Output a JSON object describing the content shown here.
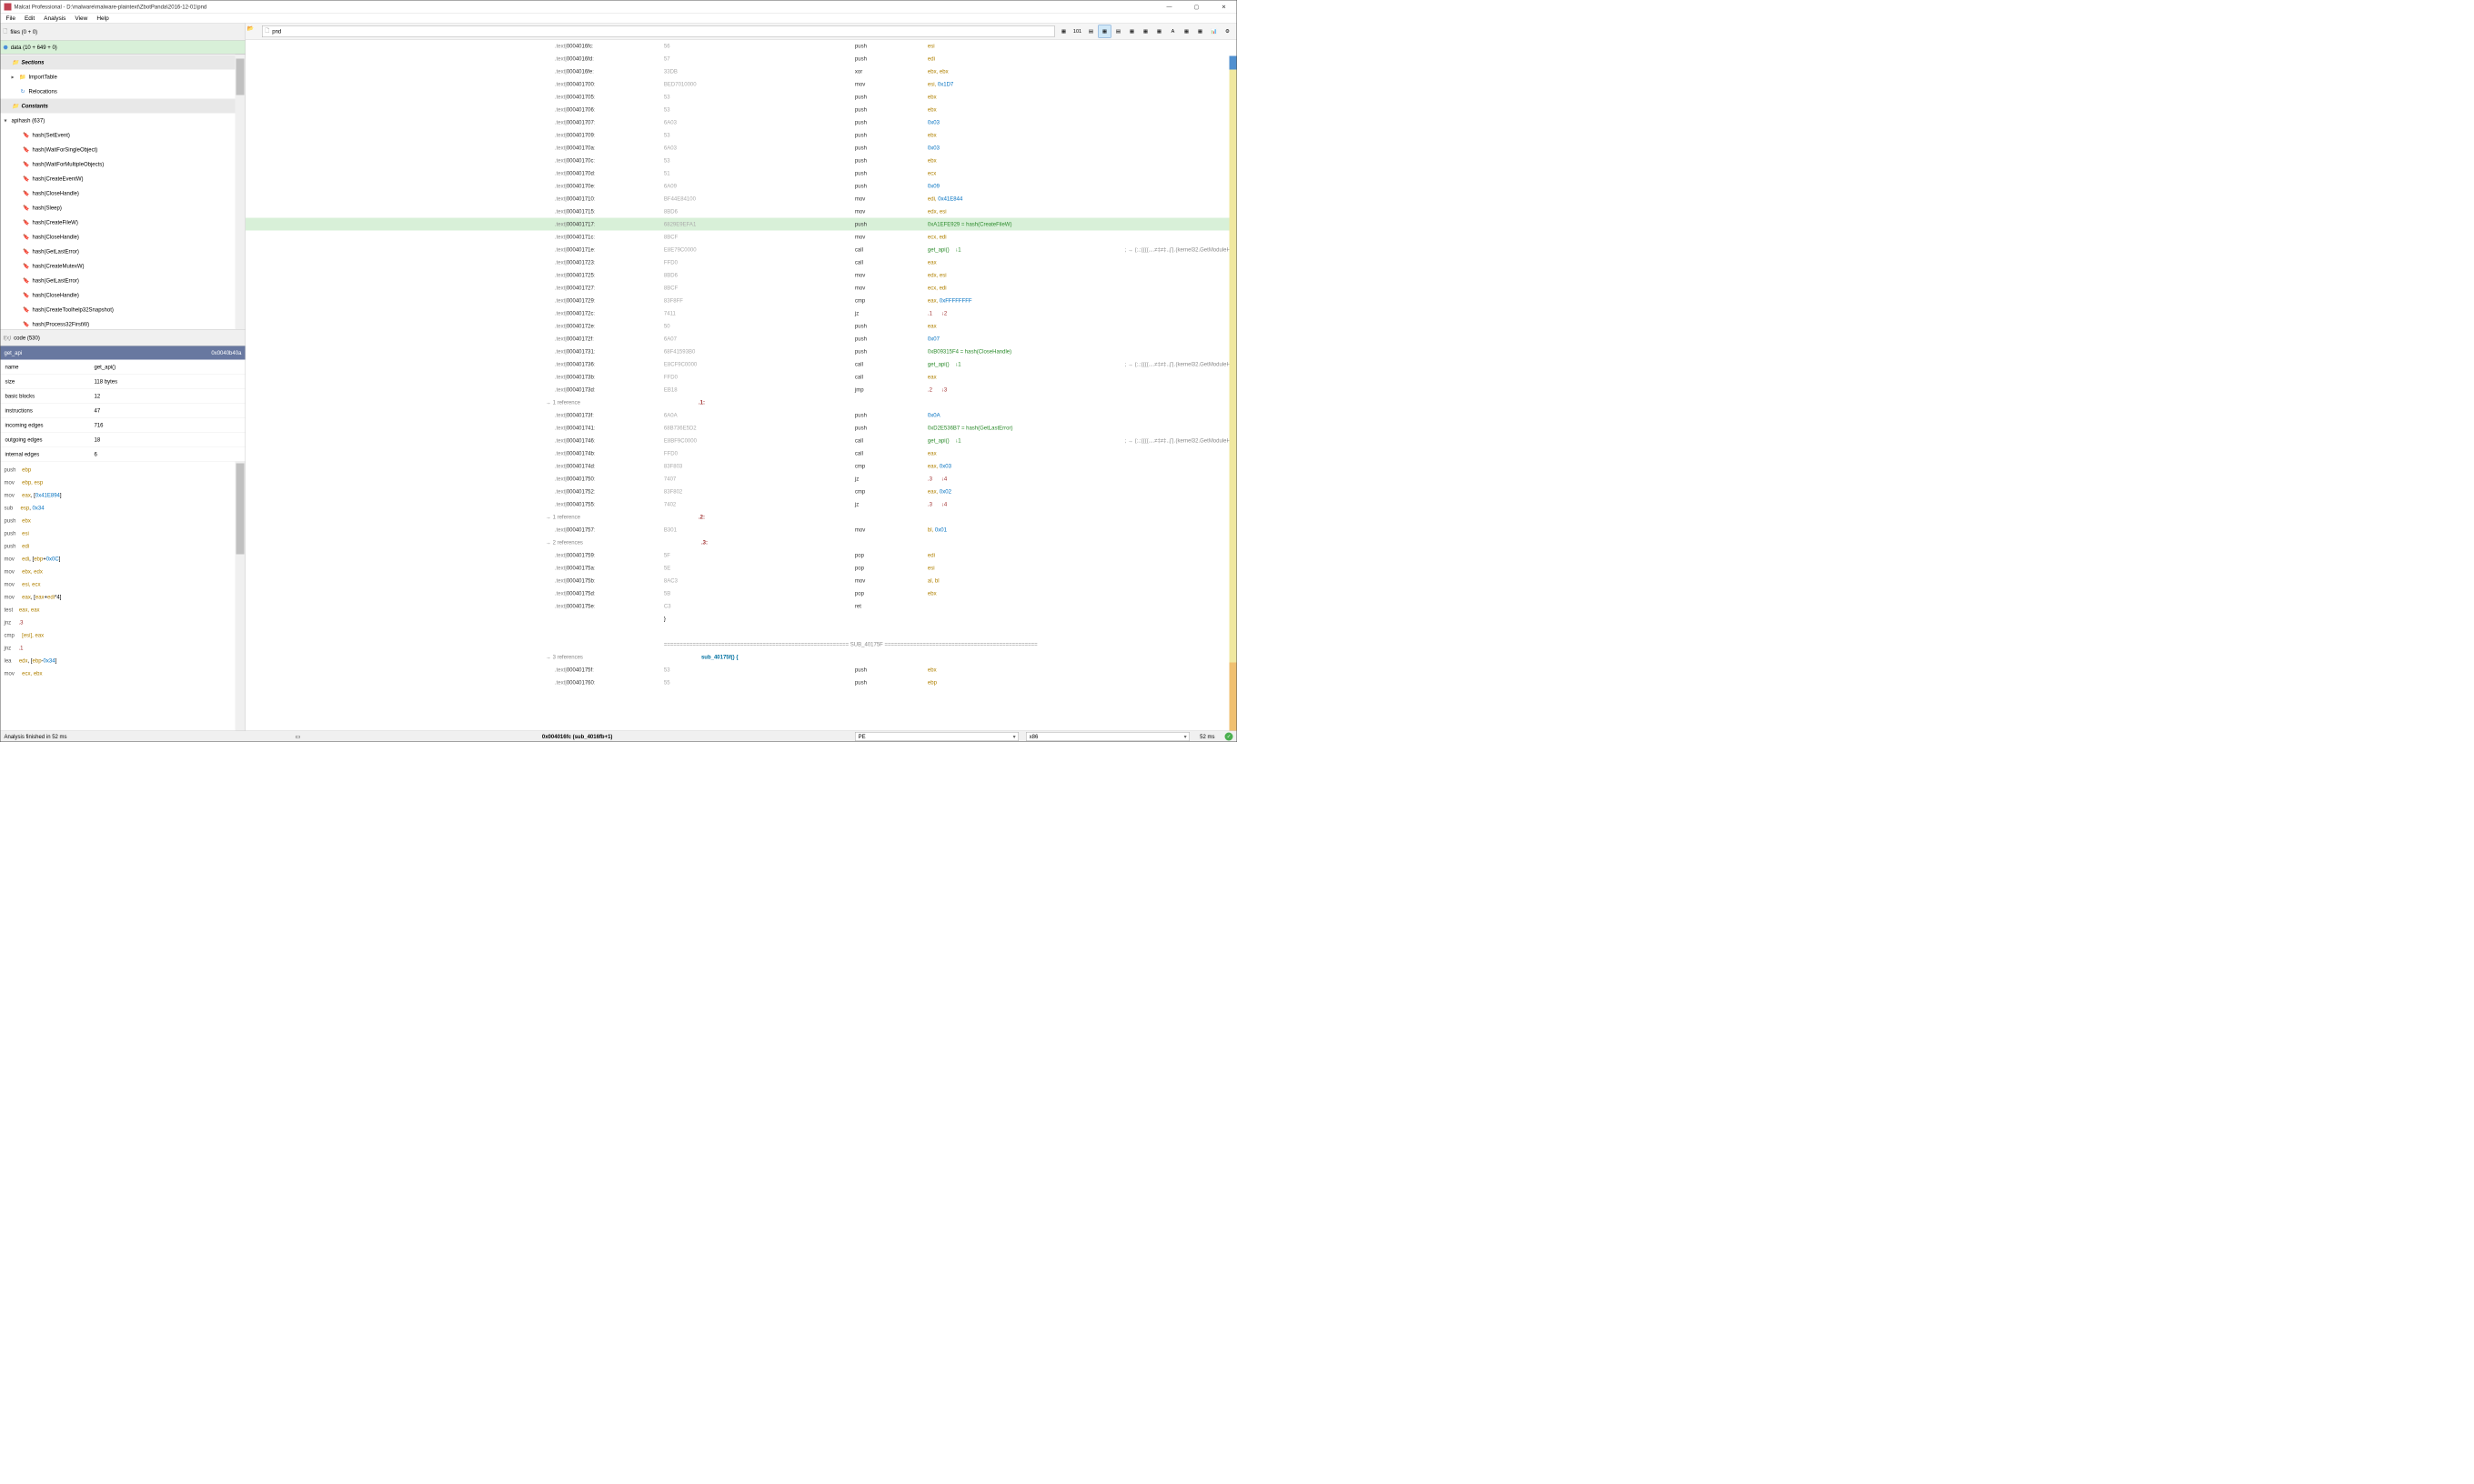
{
  "window": {
    "title": "Malcat Professional - D:\\malware\\malware-plaintext\\ZbotPanda\\2016-12-01\\pnd"
  },
  "menu": [
    "File",
    "Edit",
    "Analysis",
    "View",
    "Help"
  ],
  "files_bar": "files (0 + 0)",
  "data_bar": "data (10 + 649 + 0)",
  "tree": {
    "sections": "Sections",
    "import": "ImportTable",
    "reloc": "Relocations",
    "constants": "Constants",
    "apihash": "apihash (637)",
    "items": [
      "hash(SetEvent)",
      "hash(WaitForSingleObject)",
      "hash(WaitForMultipleObjects)",
      "hash(CreateEventW)",
      "hash(CloseHandle)",
      "hash(Sleep)",
      "hash(CreateFileW)",
      "hash(CloseHandle)",
      "hash(GetLastError)",
      "hash(CreateMutexW)",
      "hash(GetLastError)",
      "hash(CloseHandle)",
      "hash(CreateToolhelp32Snapshot)",
      "hash(Process32FirstW)"
    ]
  },
  "code_bar": "code (530)",
  "fn_info": {
    "name_hdr": "get_api",
    "addr": "0x0040b40a",
    "rows": [
      {
        "k": "name",
        "v": "get_api()"
      },
      {
        "k": "size",
        "v": "118 bytes"
      },
      {
        "k": "basic blocks",
        "v": "12"
      },
      {
        "k": "instructions",
        "v": "47"
      },
      {
        "k": "incoming edges",
        "v": "716"
      },
      {
        "k": "outgoing edges",
        "v": "18"
      },
      {
        "k": "internal edges",
        "v": "6"
      }
    ]
  },
  "preview": [
    {
      "m": "push",
      "o": "ebp",
      "t": "reg"
    },
    {
      "m": "mov",
      "o": "ebp, esp",
      "t": "reg"
    },
    {
      "m": "mov",
      "o": "eax, [0x41E894]",
      "t": "mix"
    },
    {
      "m": "sub",
      "o": "esp, 0x34",
      "t": "num"
    },
    {
      "m": "push",
      "o": "ebx",
      "t": "reg"
    },
    {
      "m": "push",
      "o": "esi",
      "t": "reg"
    },
    {
      "m": "push",
      "o": "edi",
      "t": "reg"
    },
    {
      "m": "mov",
      "o": "edi, [ebp+0x0C]",
      "t": "mix"
    },
    {
      "m": "mov",
      "o": "ebx, edx",
      "t": "reg"
    },
    {
      "m": "mov",
      "o": "esi, ecx",
      "t": "reg"
    },
    {
      "m": "mov",
      "o": "eax, [eax+edi*4]",
      "t": "mix"
    },
    {
      "m": "test",
      "o": "eax, eax",
      "t": "reg"
    },
    {
      "m": "jnz",
      "o": ".3",
      "t": "lbl"
    },
    {
      "m": "cmp",
      "o": "[esi], eax",
      "t": "reg"
    },
    {
      "m": "jnz",
      "o": ".1",
      "t": "lbl"
    },
    {
      "m": "lea",
      "o": "edx, [ebp-0x34]",
      "t": "mix"
    },
    {
      "m": "mov",
      "o": "ecx, ebx",
      "t": "reg"
    }
  ],
  "addr_input": "pnd",
  "disasm": [
    {
      "a": "000401fc",
      "h": "56",
      "m": "push",
      "o": "esi"
    },
    {
      "a": "000401fd",
      "h": "57",
      "m": "push",
      "o": "edi"
    },
    {
      "a": "000401fe",
      "h": "33DB",
      "m": "xor",
      "o": "ebx, ebx"
    },
    {
      "a": "00040170",
      "h": "BED7010000",
      "m": "mov",
      "o": "esi, 0x1D7",
      "num": true
    },
    {
      "a": "00040170",
      "h": "53",
      "m": "push",
      "o": "ebx"
    },
    {
      "a": "00040170",
      "h": "53",
      "m": "push",
      "o": "ebx"
    },
    {
      "a": "00040170",
      "h": "6A03",
      "m": "push",
      "o": "0x03",
      "num": true
    },
    {
      "a": "00040170",
      "h": "53",
      "m": "push",
      "o": "ebx"
    },
    {
      "a": "0004017a",
      "h": "6A03",
      "m": "push",
      "o": "0x03",
      "num": true
    },
    {
      "a": "0004017c",
      "h": "53",
      "m": "push",
      "o": "ebx"
    },
    {
      "a": "0004017d",
      "h": "51",
      "m": "push",
      "o": "ecx"
    },
    {
      "a": "0004017e",
      "h": "6A09",
      "m": "push",
      "o": "0x09",
      "num": true
    },
    {
      "a": "00040171",
      "h": "BF44E84100",
      "m": "mov",
      "o": "edi, 0x41E844",
      "num": true
    },
    {
      "a": "0004017:",
      "h": "8BD6",
      "m": "mov",
      "o": "edx, esi"
    },
    {
      "a": "00040171",
      "h": "6829E9EFA1",
      "m": "push",
      "o": "0xA1EFE929 = hash(CreateFileW)",
      "hl": true,
      "cm": true
    },
    {
      "a": "0004017c",
      "h": "8BCF",
      "m": "mov",
      "o": "ecx, edi"
    },
    {
      "a": "0004017e",
      "h": "E8E79C0000",
      "m": "call",
      "o": "get_api()    ↓1",
      "cm": true,
      "cmt": "; → (:.:((((....≠‡≠‡..∏.(kernel32.GetModuleHan"
    },
    {
      "a": "0004017:",
      "h": "FFD0",
      "m": "call",
      "o": "eax"
    },
    {
      "a": "0004017:",
      "h": "8BD6",
      "m": "mov",
      "o": "edx, esi"
    },
    {
      "a": "0004017:",
      "h": "8BCF",
      "m": "mov",
      "o": "ecx, edi"
    },
    {
      "a": "0004017:",
      "h": "83F8FF",
      "m": "cmp",
      "o": "eax, 0xFFFFFFFF",
      "num": true
    },
    {
      "a": "0004017:",
      "h": "7411",
      "m": "jz",
      "o": ".1      ↓2",
      "lbl": true
    },
    {
      "a": "0004017e",
      "h": "50",
      "m": "push",
      "o": "eax"
    },
    {
      "a": "0004017f",
      "h": "6A07",
      "m": "push",
      "o": "0x07",
      "num": true
    },
    {
      "a": "0004017:",
      "h": "68F41593B0",
      "m": "push",
      "o": "0xB09315F4 = hash(CloseHandle)",
      "cm": true
    },
    {
      "a": "0004017:",
      "h": "E8CF9C0000",
      "m": "call",
      "o": "get_api()    ↓1",
      "cm": true,
      "cmt": "; → (:.:((((....≠‡≠‡..∏.(kernel32.GetModuleHan"
    },
    {
      "a": "0004017b",
      "h": "FFD0",
      "m": "call",
      "o": "eax"
    },
    {
      "a": "0004017d",
      "h": "EB18",
      "m": "jmp",
      "o": ".2      ↓3",
      "lbl": true
    }
  ],
  "ref1": "→ 1 reference",
  "loc1": ".1:",
  "disasm2": [
    {
      "a": "0004017f",
      "h": "6A0A",
      "m": "push",
      "o": "0x0A",
      "num": true
    },
    {
      "a": "0004017:",
      "h": "68B736E5D2",
      "m": "push",
      "o": "0xD2E536B7 = hash(GetLastError)",
      "cm": true
    },
    {
      "a": "0004017:",
      "h": "E8BF9C0000",
      "m": "call",
      "o": "get_api()    ↓1",
      "cm": true,
      "cmt": "; → (:.:((((....≠‡≠‡..∏.(kernel32.GetModuleHan"
    },
    {
      "a": "0004017b",
      "h": "FFD0",
      "m": "call",
      "o": "eax"
    },
    {
      "a": "0004017d",
      "h": "83F803",
      "m": "cmp",
      "o": "eax, 0x03",
      "num": true
    },
    {
      "a": "0004017:",
      "h": "7407",
      "m": "jz",
      "o": ".3      ↓4",
      "lbl": true
    },
    {
      "a": "0004017:",
      "h": "83F802",
      "m": "cmp",
      "o": "eax, 0x02",
      "num": true
    },
    {
      "a": "0004017:",
      "h": "7402",
      "m": "jz",
      "o": ".3      ↓4",
      "lbl": true
    }
  ],
  "ref2": "→ 1 reference",
  "loc2": ".2:",
  "disasm3": [
    {
      "a": "0004017:",
      "h": "B301",
      "m": "mov",
      "o": "bl, 0x01",
      "num": true
    }
  ],
  "ref3": "→ 2 references",
  "loc3": ".3:",
  "disasm4": [
    {
      "a": "0004017:",
      "h": "5F",
      "m": "pop",
      "o": "edi"
    },
    {
      "a": "0004017a",
      "h": "5E",
      "m": "pop",
      "o": "esi"
    },
    {
      "a": "0004017b",
      "h": "8AC3",
      "m": "mov",
      "o": "al, bl"
    },
    {
      "a": "0004017d",
      "h": "5B",
      "m": "pop",
      "o": "ebx"
    },
    {
      "a": "0004017e",
      "h": "C3",
      "m": "ret",
      "o": ""
    }
  ],
  "closebrace": "}",
  "subdiv": "========================================================== SUB_40175F ================================================",
  "ref4": "→ 3 references",
  "subname": "sub_40175f() {",
  "disasm5": [
    {
      "a": "0004017f",
      "h": "53",
      "m": "push",
      "o": "ebx"
    },
    {
      "a": "0004017:",
      "h": "55",
      "m": "push",
      "o": "ebp"
    }
  ],
  "addrs": {
    "0": "0004016fc",
    "1": "0004016fd",
    "2": "0004016fe",
    "3": "000401700",
    "4": "000401705",
    "5": "000401706",
    "6": "000401707",
    "7": "000401709",
    "8": "00040170a",
    "9": "00040170c",
    "10": "00040170d",
    "11": "00040170e",
    "12": "000401710",
    "13": "000401715",
    "14": "000401717",
    "15": "00040171c",
    "16": "00040171e",
    "17": "000401723",
    "18": "000401725",
    "19": "000401727",
    "20": "000401729",
    "21": "00040172c",
    "22": "00040172e",
    "23": "00040172f",
    "24": "000401731",
    "25": "000401736",
    "26": "00040173b",
    "27": "00040173d",
    "28": "00040173f",
    "29": "000401741",
    "30": "000401746",
    "31": "00040174b",
    "32": "00040174d",
    "33": "000401750",
    "34": "000401752",
    "35": "000401755",
    "36": "000401757",
    "37": "000401759",
    "38": "00040175a",
    "39": "00040175b",
    "40": "00040175d",
    "41": "00040175e",
    "42": "00040175f",
    "43": "000401760"
  },
  "status": {
    "left": "Analysis finished in 52 ms",
    "mid": "0x004016fc (sub_4016fb+1)",
    "sel1": "PE",
    "sel2": "x86",
    "time": "52 ms"
  }
}
